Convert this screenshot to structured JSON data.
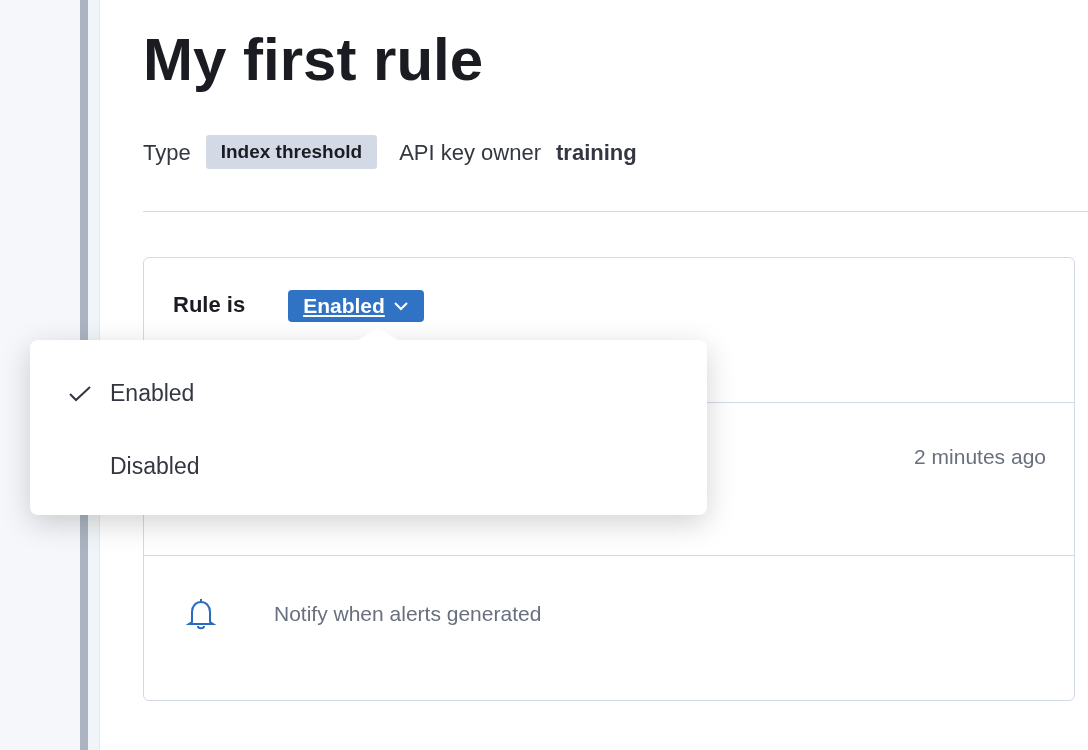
{
  "title": "My first rule",
  "meta": {
    "type_label": "Type",
    "type_badge": "Index threshold",
    "owner_label": "API key owner",
    "owner": "training"
  },
  "status": {
    "label": "Rule is",
    "button": "Enabled",
    "menu": [
      {
        "label": "Enabled",
        "selected": true
      },
      {
        "label": "Disabled",
        "selected": false
      }
    ]
  },
  "last_updated": "2 minutes ago",
  "notify": "Notify when alerts generated"
}
